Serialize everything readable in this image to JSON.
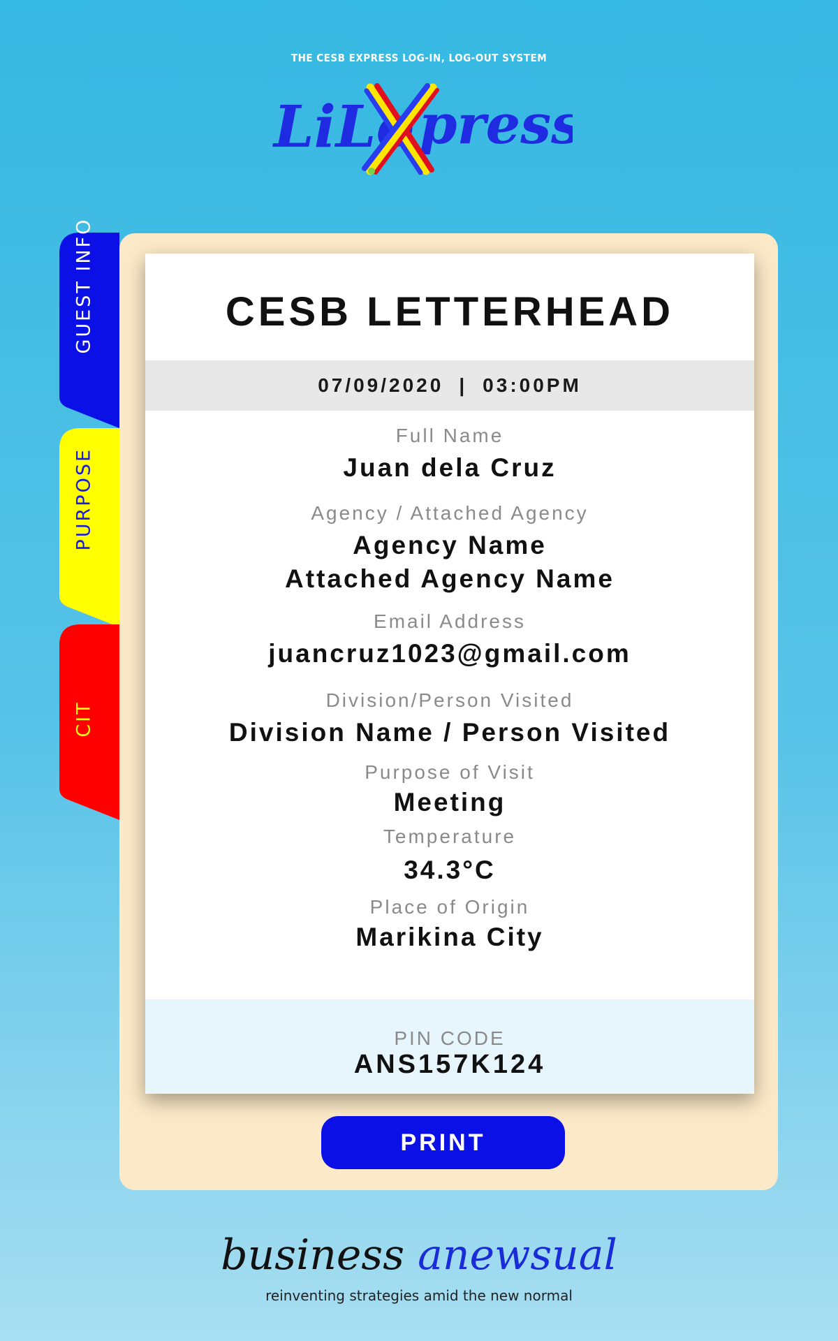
{
  "header": {
    "tagline": "THE CESB EXPRESS LOG-IN, LOG-OUT SYSTEM",
    "logo_text": "LiLoXpress"
  },
  "tabs": [
    {
      "label": "GUEST INFO",
      "color": "#0a10e6",
      "text_color": "#ffffff"
    },
    {
      "label": "PURPOSE",
      "color": "#ffff00",
      "text_color": "#1a1ae0"
    },
    {
      "label": "CIT",
      "color": "#ff0000",
      "text_color": "#ffff00"
    }
  ],
  "card": {
    "title": "CESB LETTERHEAD",
    "date": "07/09/2020",
    "separator": "|",
    "time": "03:00PM",
    "fields": {
      "full_name": {
        "label": "Full Name",
        "value": "Juan dela Cruz"
      },
      "agency": {
        "label": "Agency / Attached Agency",
        "value": "Agency Name",
        "value2": "Attached Agency Name"
      },
      "email": {
        "label": "Email Address",
        "value": "juancruz1023@gmail.com"
      },
      "division": {
        "label": "Division/Person Visited",
        "value": "Division Name / Person Visited"
      },
      "purpose": {
        "label": "Purpose of Visit",
        "value": "Meeting"
      },
      "temperature": {
        "label": "Temperature",
        "value": "34.3°C"
      },
      "origin": {
        "label": "Place of Origin",
        "value": "Marikina City"
      }
    },
    "pin": {
      "label": "PIN CODE",
      "value": "ANS157K124"
    }
  },
  "actions": {
    "print_label": "PRINT"
  },
  "footer": {
    "brand_part1": "business",
    "brand_part2": "anewsual",
    "subtitle": "reinventing strategies amid the new normal"
  },
  "colors": {
    "background": "#35b8e2",
    "tray": "#fbe9c7",
    "primary_button": "#0a10e6"
  }
}
